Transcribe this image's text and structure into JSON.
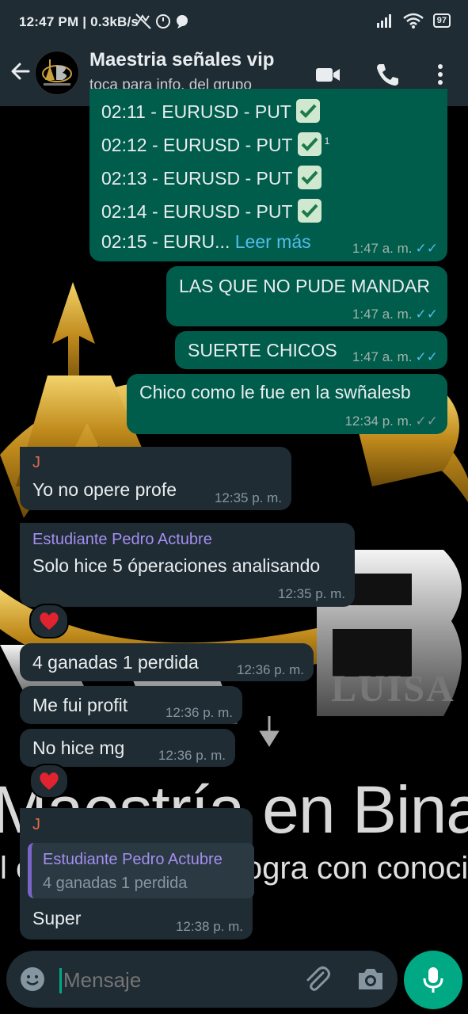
{
  "status_bar": {
    "time": "12:47 PM",
    "speed": "0.3kB/s",
    "battery": "97"
  },
  "header": {
    "title": "Maestria señales vip",
    "subtitle": "toca para info. del grupo"
  },
  "wallpaper": {
    "big_text": "Maestría en Binar",
    "sub_text_left": "l é",
    "sub_text_right": "logra con conocimie",
    "side_text": "LUISA"
  },
  "messages": {
    "signals": {
      "lines": [
        "02:11 - EURUSD - PUT",
        "02:12 - EURUSD - PUT",
        "02:13 - EURUSD - PUT",
        "02:14 - EURUSD - PUT"
      ],
      "sup": "1",
      "truncated": "02:15 - EURU...",
      "read_more": "Leer más",
      "time": "1:47 a. m."
    },
    "m1": {
      "text": "LAS QUE NO PUDE MANDAR",
      "time": "1:47 a. m."
    },
    "m2": {
      "text": "SUERTE CHICOS",
      "time": "1:47 a. m."
    },
    "m3": {
      "text": "Chico como le fue en la swñalesb",
      "time": "12:34 p. m."
    },
    "m4": {
      "sender": "J",
      "text": "Yo no opere profe",
      "time": "12:35 p. m."
    },
    "m5": {
      "sender": "Estudiante Pedro Actubre",
      "text": "Solo hice 5 óperaciones analisando",
      "time": "12:35 p. m."
    },
    "m6": {
      "text": "4 ganadas 1 perdida",
      "time": "12:36 p. m."
    },
    "m7": {
      "text": "Me fui profit",
      "time": "12:36 p. m."
    },
    "m8": {
      "text": "No hice mg",
      "time": "12:36 p. m."
    },
    "m9": {
      "sender": "J",
      "quote_sender": "Estudiante Pedro Actubre",
      "quote_text": "4 ganadas 1 perdida",
      "text": "Super",
      "time": "12:38 p. m."
    }
  },
  "input": {
    "placeholder": "Mensaje"
  },
  "colors": {
    "outgoing": "#005c4b",
    "incoming": "#1f2c34",
    "accent": "#00a884",
    "sender_j": "#e26a4a",
    "sender_pedro": "#a48ef0",
    "read_ticks": "#53bdeb"
  }
}
